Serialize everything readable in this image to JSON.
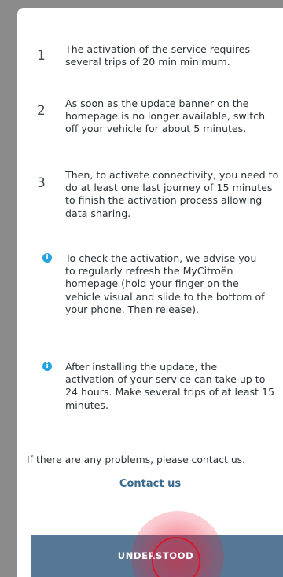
{
  "steps": [
    {
      "number": "1",
      "text": "The activation of the service requires\nseveral trips of 20 min minimum."
    },
    {
      "number": "2",
      "text": "As soon as the update banner on the\nhomepage is no longer available, switch\noff your vehicle for about 5 minutes."
    },
    {
      "number": "3",
      "text": "Then, to activate connectivity, you need to\ndo at least one last journey of 15 minutes\nto finish the activation process allowing\ndata sharing."
    }
  ],
  "infos": [
    {
      "icon": "info-icon",
      "text": "To check the activation, we advise you\nto regularly refresh the MyCitroën\nhomepage (hold your finger on the\nvehicle visual and slide to the bottom of\nyour phone. Then release)."
    },
    {
      "icon": "info-icon",
      "text": "After installing the update, the\nactivation of your service can take up to\n24 hours. Make several trips of at least 15\nminutes."
    }
  ],
  "problems_text": "If there are any problems, please contact us.",
  "contact_link": "Contact us",
  "understood_button": "UNDERSTOOD",
  "colors": {
    "accent": "#3a6a8d",
    "button": "#577894",
    "info": "#27a3e0",
    "tap": "#d71a2b"
  }
}
